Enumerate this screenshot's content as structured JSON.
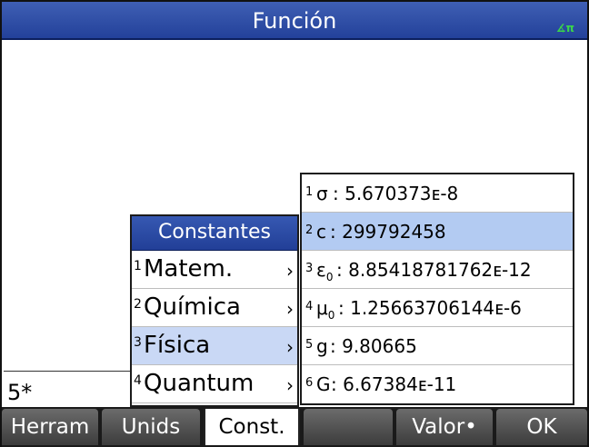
{
  "titlebar": {
    "title": "Función",
    "angle_indicator": "∡π"
  },
  "entry": {
    "text": "5*"
  },
  "constants_menu": {
    "header": "Constantes",
    "items": [
      {
        "num": "1",
        "label": "Matem.",
        "arrow": "›"
      },
      {
        "num": "2",
        "label": "Química",
        "arrow": "›"
      },
      {
        "num": "3",
        "label": "Física",
        "arrow": "›",
        "selected": true
      },
      {
        "num": "4",
        "label": "Quantum",
        "arrow": "›"
      }
    ]
  },
  "physics_menu": {
    "items": [
      {
        "num": "1",
        "symbol": "σ",
        "sub": "",
        "value": ": 5.670373ᴇ-8"
      },
      {
        "num": "2",
        "symbol": "c",
        "sub": "",
        "value": ": 299792458",
        "selected": true
      },
      {
        "num": "3",
        "symbol": "ε",
        "sub": "0",
        "value": ": 8.85418781762ᴇ-12"
      },
      {
        "num": "4",
        "symbol": "μ",
        "sub": "0",
        "value": ": 1.25663706144ᴇ-6"
      },
      {
        "num": "5",
        "symbol": "g",
        "sub": "",
        "value": ": 9.80665"
      },
      {
        "num": "6",
        "symbol": "G",
        "sub": "",
        "value": ": 6.67384ᴇ-11"
      }
    ]
  },
  "menubar": {
    "keys": [
      "Herram",
      "Unids",
      "Const.",
      "",
      "Valor•",
      "OK"
    ]
  },
  "colors": {
    "title_bar": "#23419a",
    "selected_row": "#b3cbf2",
    "angle_indicator": "#3ad64a"
  }
}
